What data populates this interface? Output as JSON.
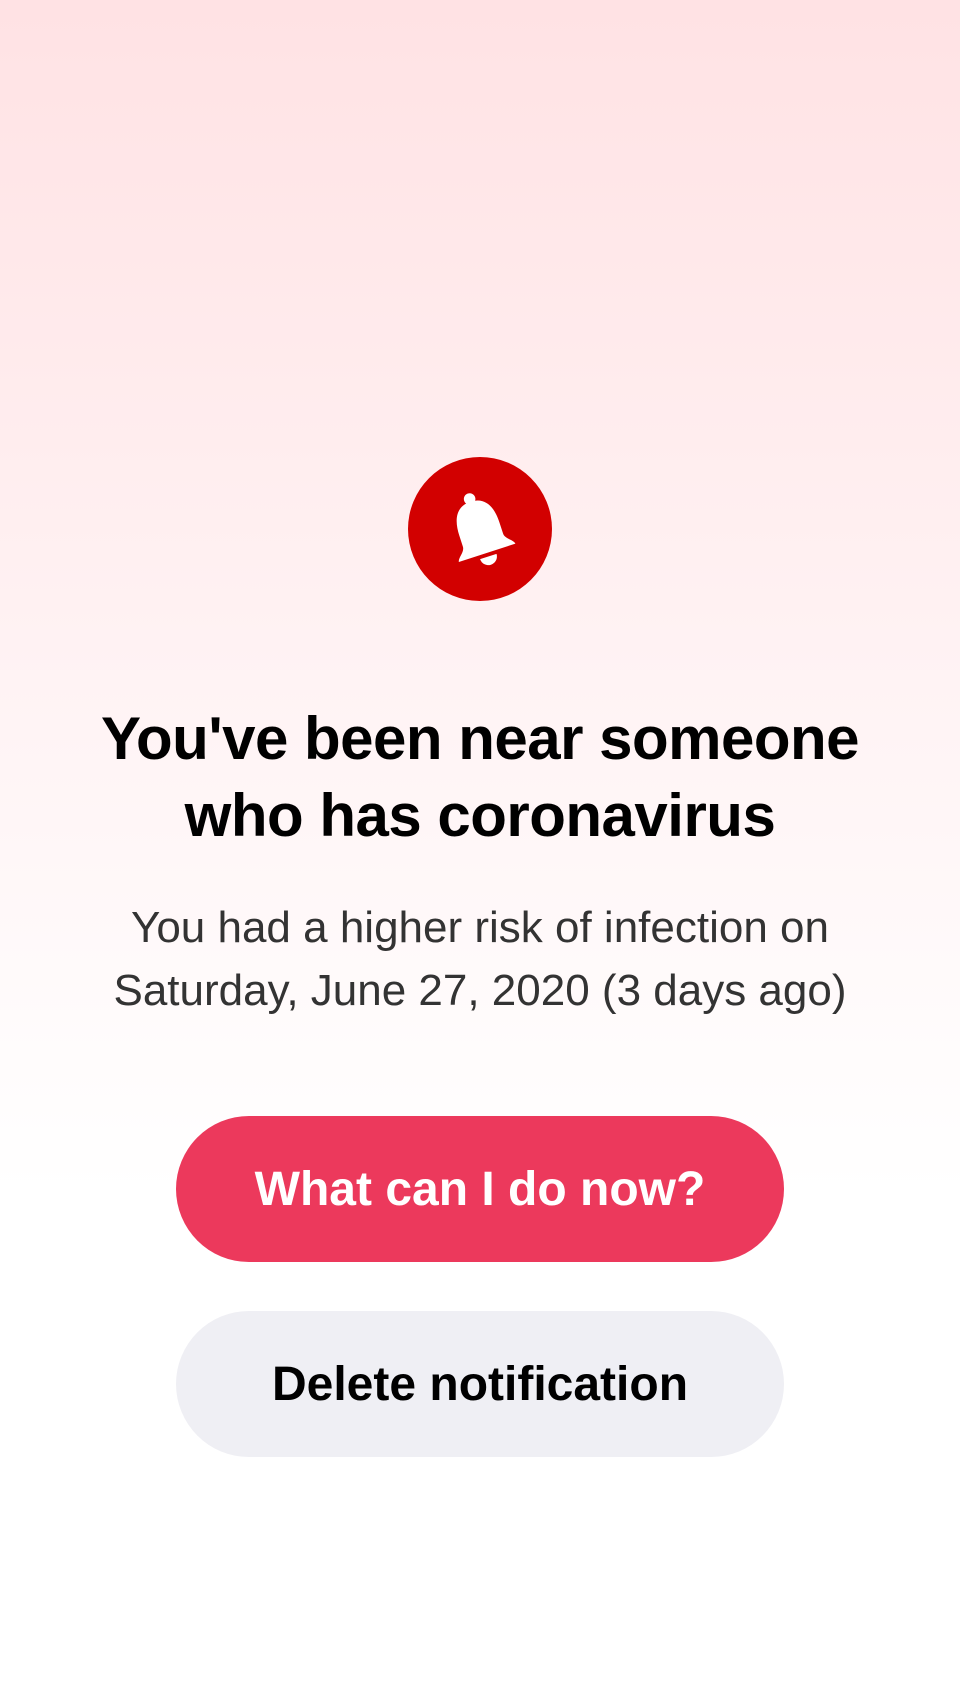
{
  "alert": {
    "icon": "bell-icon",
    "icon_color": "#d20000"
  },
  "notice": {
    "title": "You've been near someone who has coronavirus",
    "subtitle": "You had a higher risk of infection on Saturday, June 27, 2020 (3 days ago)"
  },
  "actions": {
    "primary_label": "What can I do now?",
    "primary_color": "#ec395c",
    "secondary_label": "Delete notification",
    "secondary_color": "#efeff4"
  }
}
